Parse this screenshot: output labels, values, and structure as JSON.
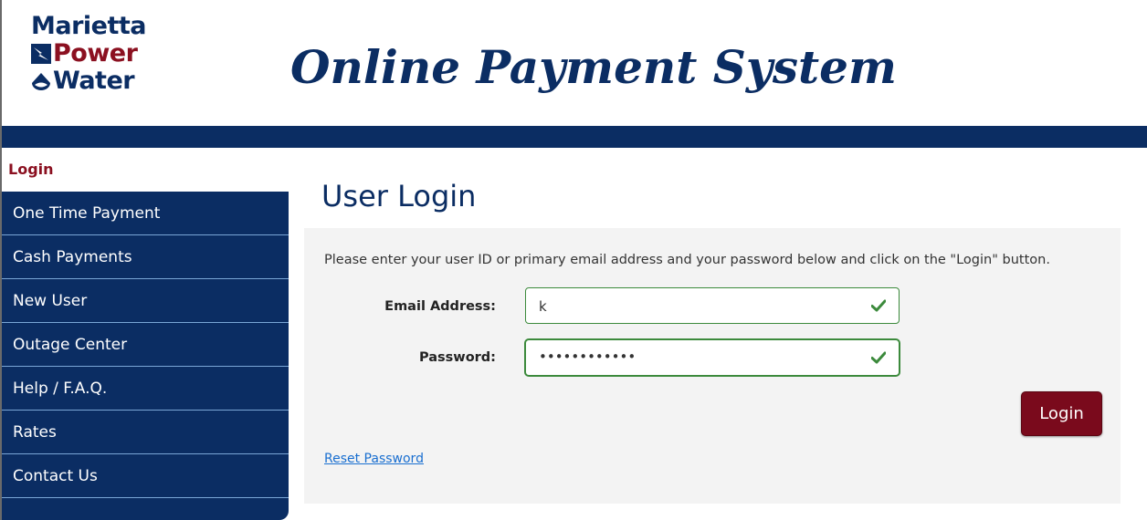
{
  "header": {
    "logo": {
      "line1": "Marietta",
      "line2": "Power",
      "line3": "Water"
    },
    "title": "Online Payment System"
  },
  "sidebar": {
    "active_label": "Login",
    "items": [
      {
        "label": "One Time Payment"
      },
      {
        "label": "Cash Payments"
      },
      {
        "label": "New User"
      },
      {
        "label": "Outage Center"
      },
      {
        "label": "Help / F.A.Q."
      },
      {
        "label": "Rates"
      },
      {
        "label": "Contact Us"
      }
    ]
  },
  "main": {
    "heading": "User Login",
    "instructions": "Please enter your user ID or primary email address and your password below and click on the \"Login\" button.",
    "email": {
      "label": "Email Address:",
      "value": "k"
    },
    "password": {
      "label": "Password:",
      "value": "••••••••••••"
    },
    "login_label": "Login",
    "reset_label": "Reset Password"
  },
  "colors": {
    "navy": "#0b2d63",
    "maroon": "#8b1020",
    "button": "#7a0a1c",
    "valid_green": "#3c8a3c",
    "link": "#1a6fd0",
    "panel": "#f3f3f3"
  }
}
